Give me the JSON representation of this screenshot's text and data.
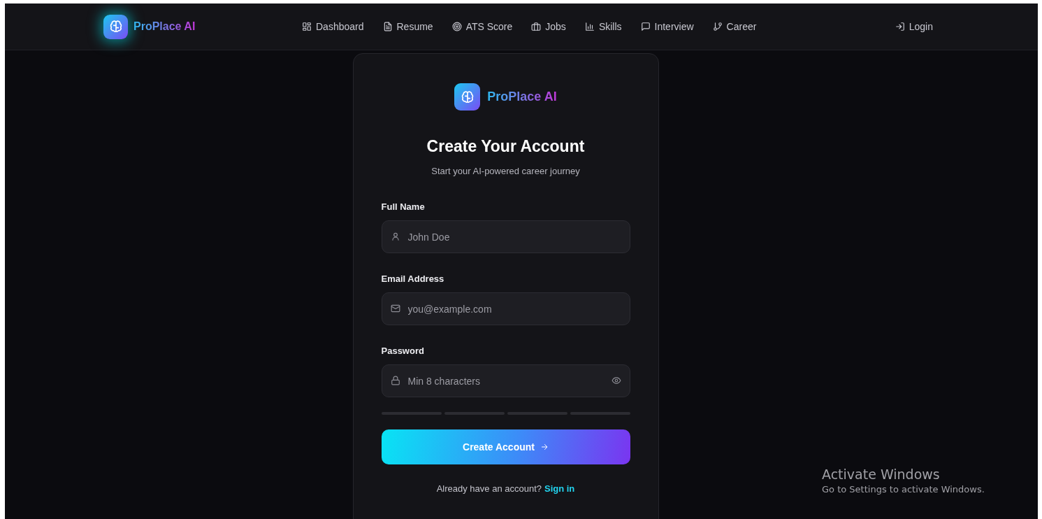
{
  "navbar": {
    "brand": "ProPlace AI",
    "links": [
      {
        "label": "Dashboard",
        "selected": false
      },
      {
        "label": "Resume",
        "selected": false
      },
      {
        "label": "ATS Score",
        "selected": false
      },
      {
        "label": "Jobs",
        "selected": false
      },
      {
        "label": "Skills",
        "selected": false
      },
      {
        "label": "Interview",
        "selected": false
      },
      {
        "label": "Career",
        "selected": false
      }
    ],
    "login": "Login"
  },
  "card": {
    "brand": "ProPlace AI",
    "title": "Create Your Account",
    "subtitle": "Start your AI-powered career journey",
    "fields": [
      {
        "kind": "name",
        "label": "Full Name",
        "placeholder": "John Doe"
      },
      {
        "kind": "email",
        "label": "Email Address",
        "placeholder": "you@example.com"
      },
      {
        "kind": "password",
        "label": "Password",
        "placeholder": "Min 8 characters"
      }
    ],
    "strength": [
      {
        "filled": false
      },
      {
        "filled": false
      },
      {
        "filled": false
      },
      {
        "filled": false
      }
    ],
    "submit": "Create Account",
    "footer_text": "Already have an account?",
    "footer_link": "Sign in"
  },
  "os_overlay": {
    "title": "Activate Windows",
    "subtitle": "Go to Settings to activate Windows."
  }
}
